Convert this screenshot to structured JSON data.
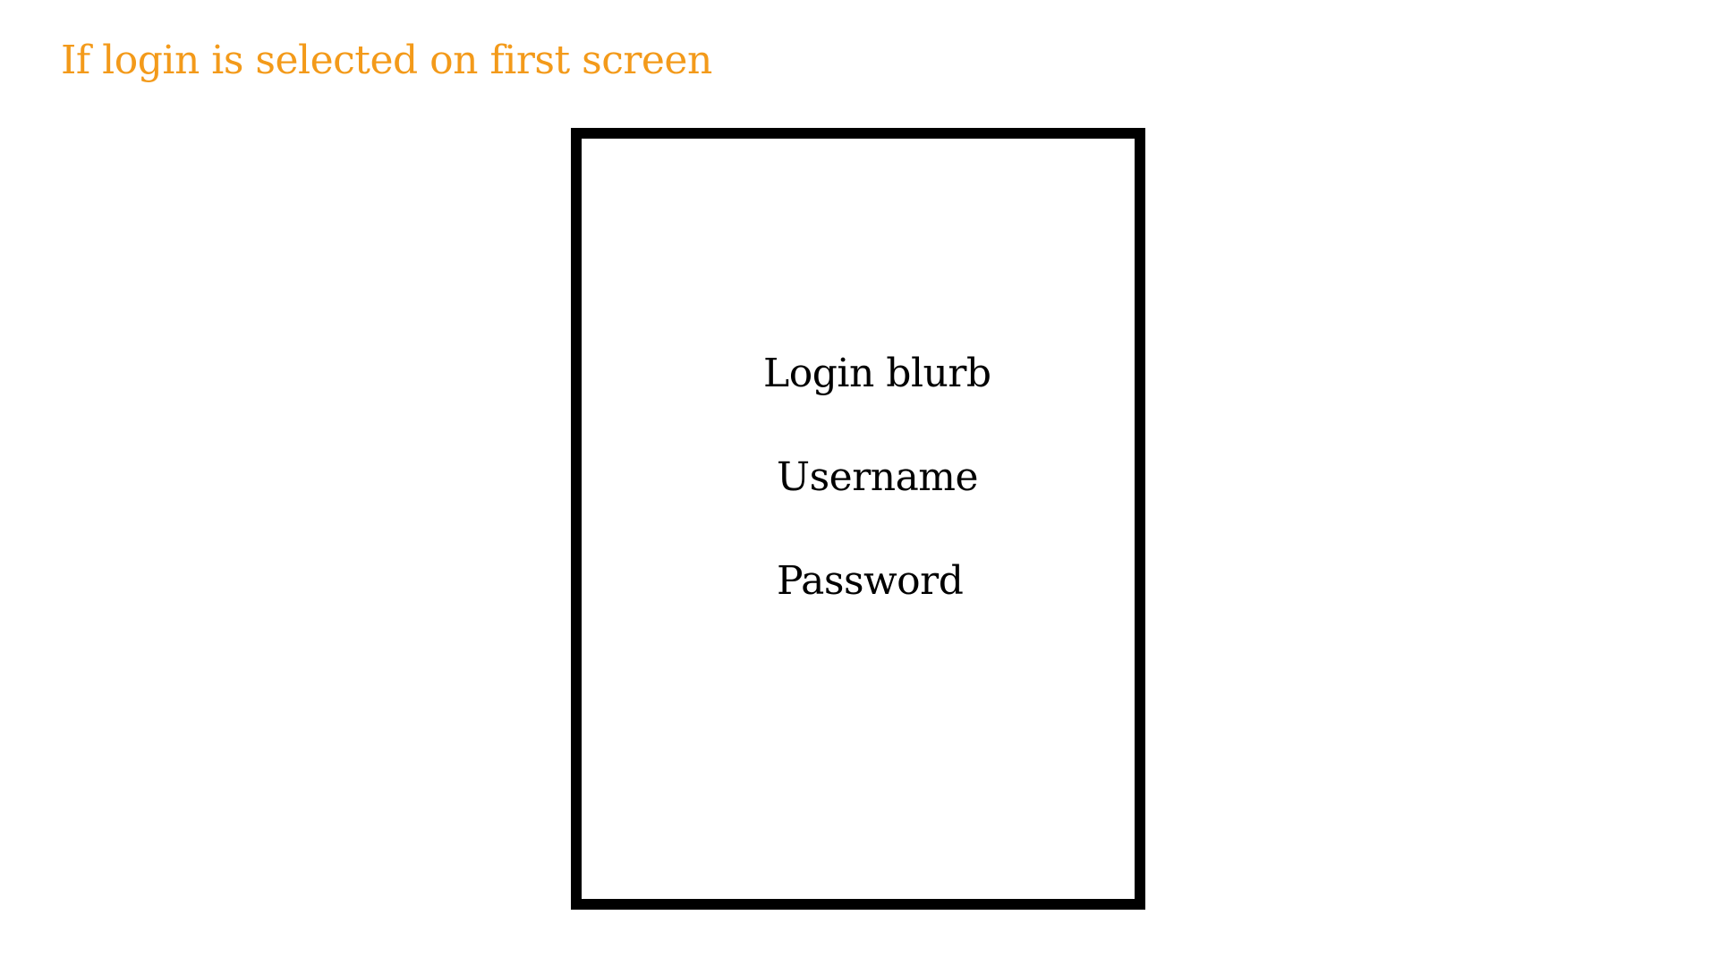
{
  "heading": "If login is selected on first screen",
  "login_screen": {
    "blurb": "Login blurb",
    "username_label": "Username",
    "password_label": "Password"
  },
  "colors": {
    "heading": "#f39a1a",
    "frame_border": "#000000",
    "text": "#000000",
    "background": "#ffffff"
  }
}
